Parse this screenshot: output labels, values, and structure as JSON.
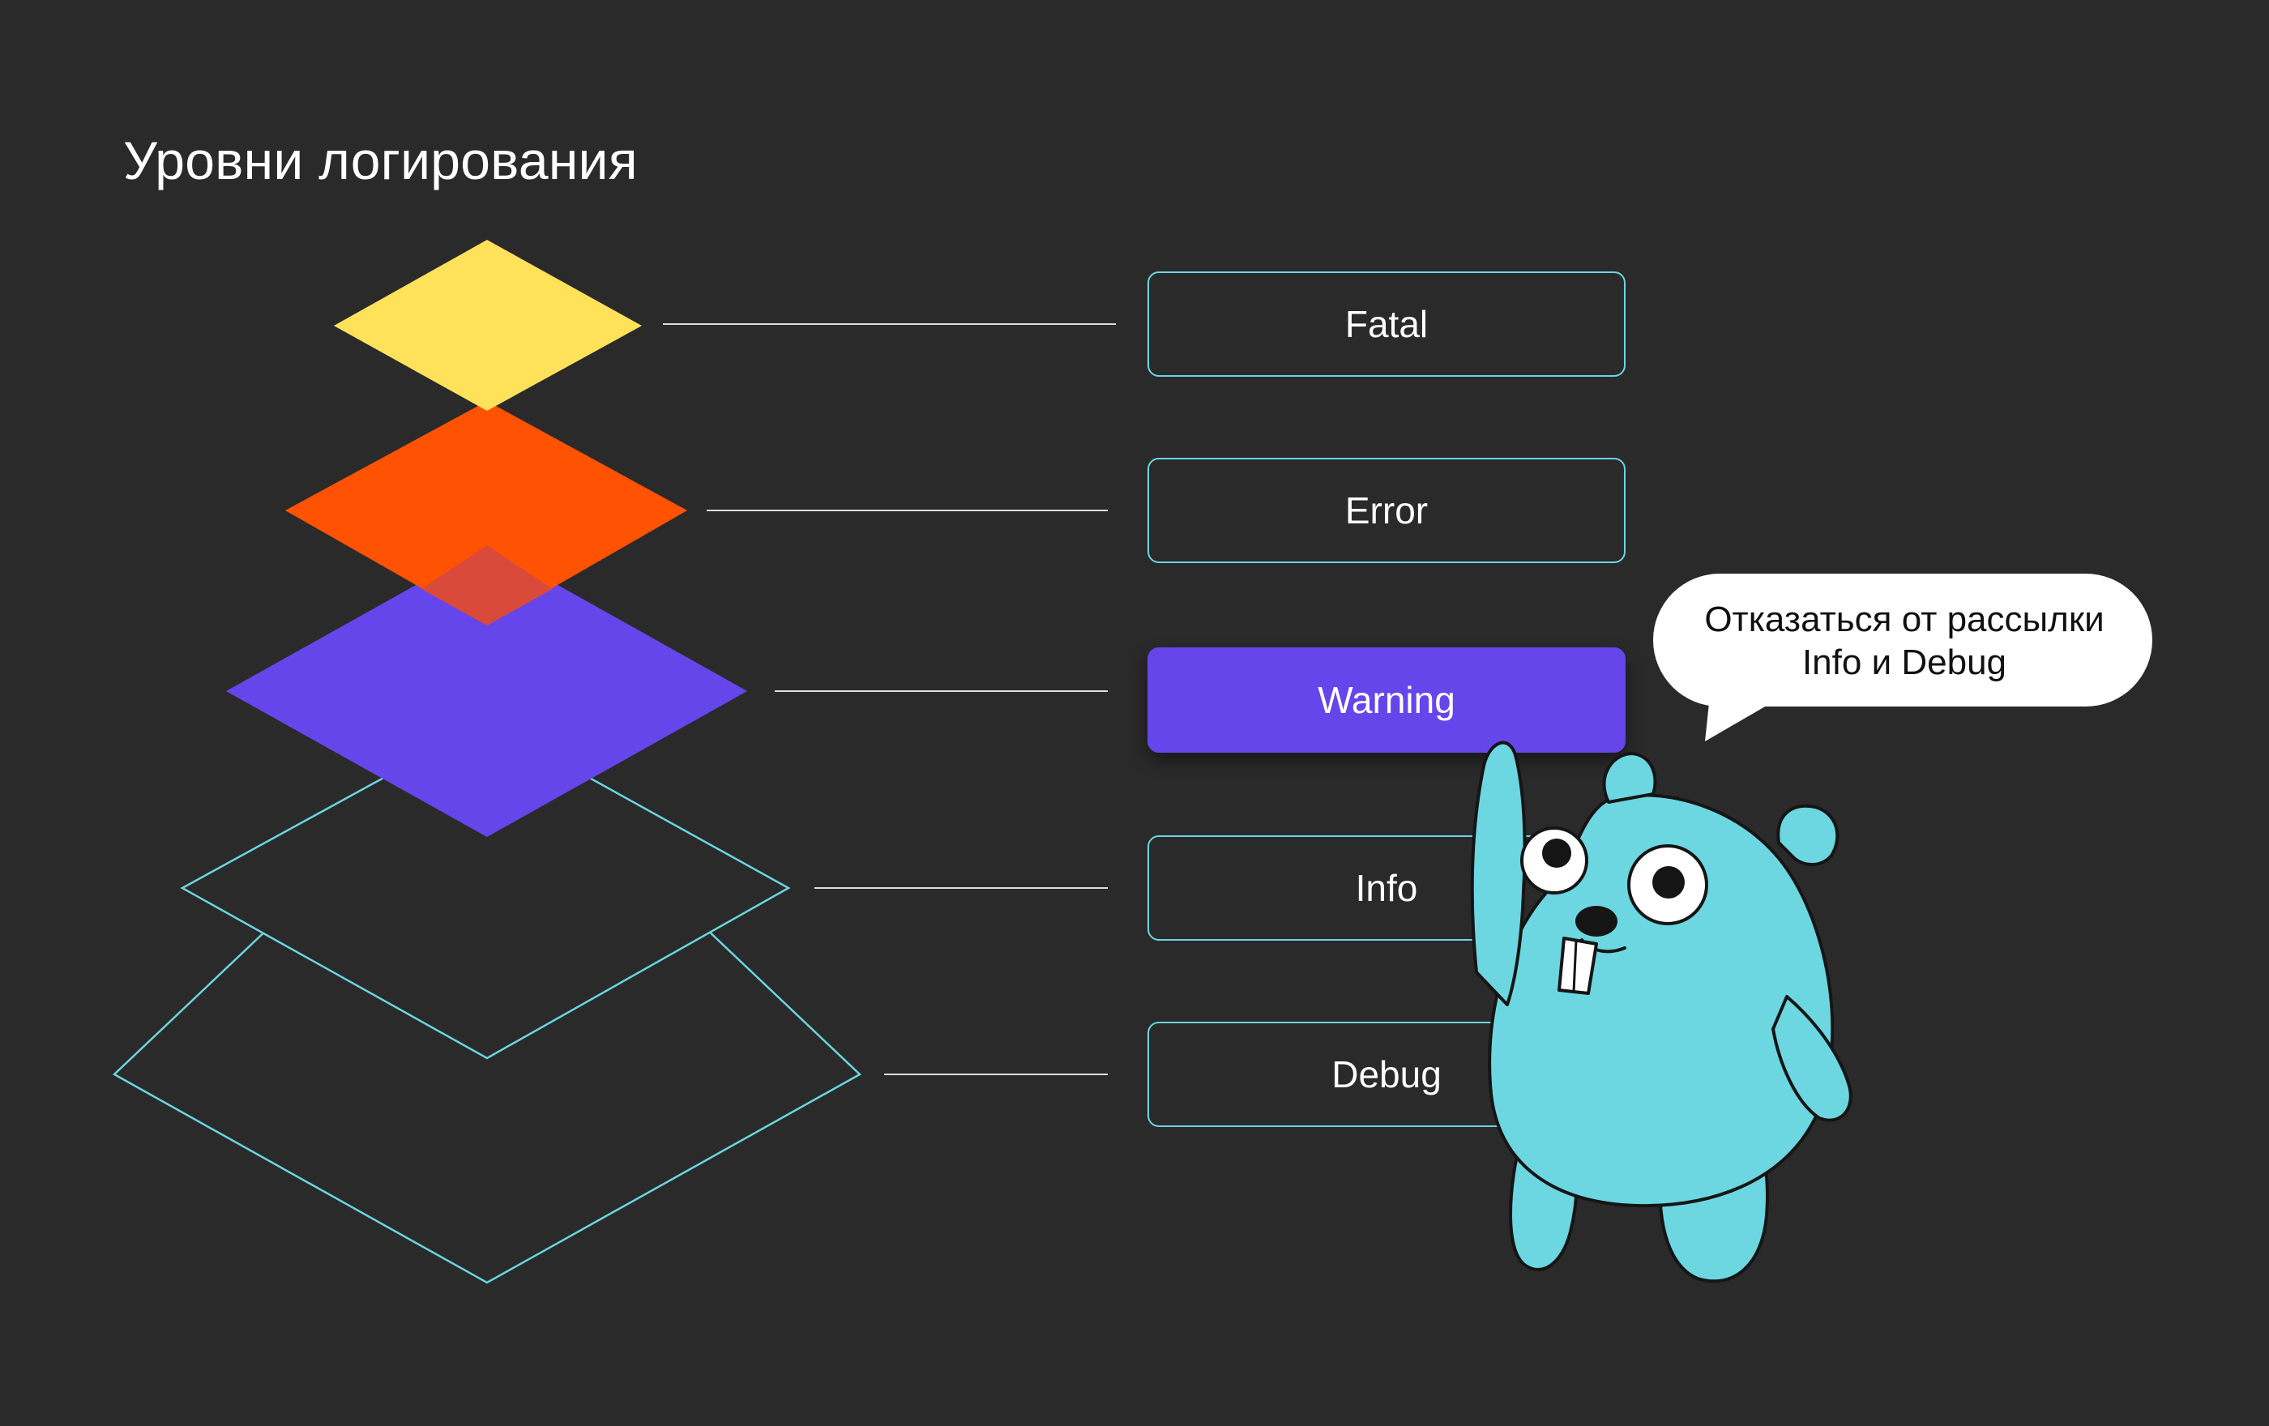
{
  "title": "Уровни логирования",
  "levels": [
    {
      "label": "Fatal"
    },
    {
      "label": "Error"
    },
    {
      "label": "Warning",
      "active": true
    },
    {
      "label": "Info"
    },
    {
      "label": "Debug"
    }
  ],
  "colors": {
    "background": "#2a2a2b",
    "fatal": "#ffe15a",
    "error": "#ff5203",
    "warning": "#6546ea",
    "outline": "#6ad5e0",
    "gopher": "#6cd6e1"
  },
  "speech_bubble": {
    "line1": "Отказаться от рассылки",
    "line2": "Info и Debug"
  },
  "mascot": "go-gopher"
}
